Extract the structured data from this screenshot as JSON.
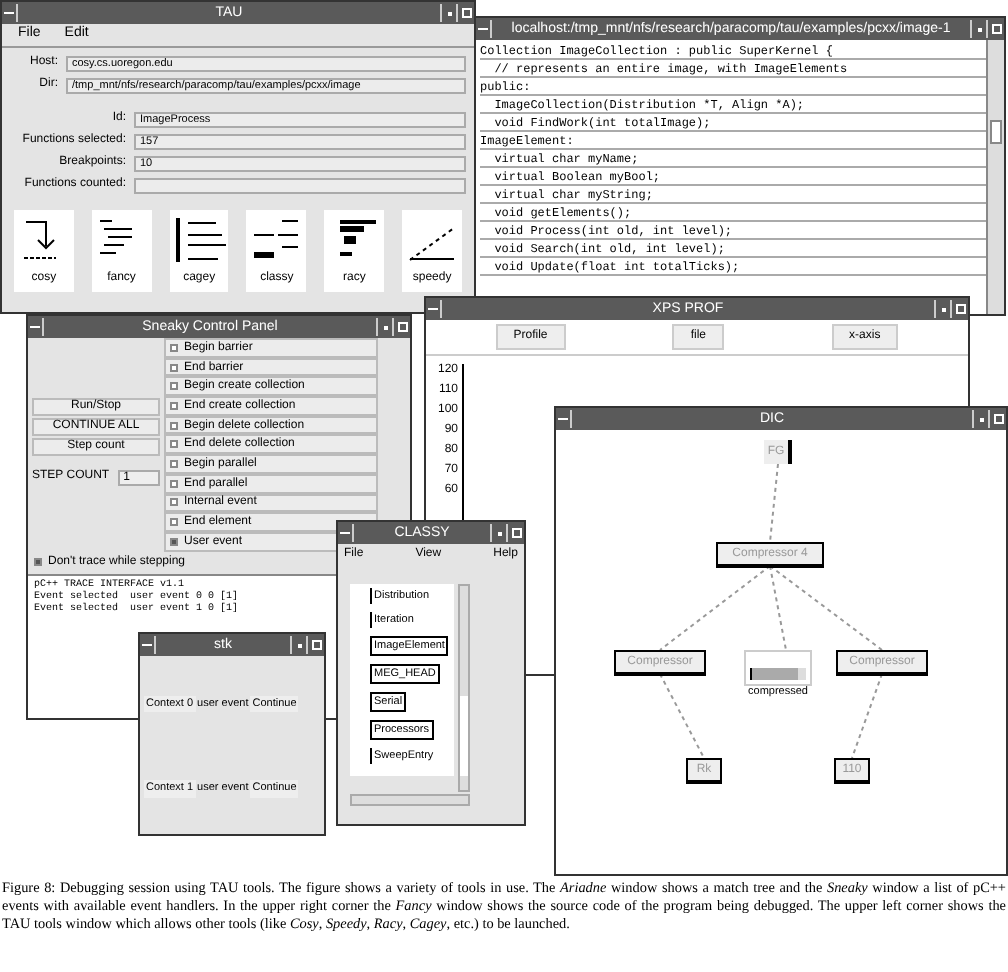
{
  "tau": {
    "title": "TAU",
    "menu": [
      "File",
      "Edit"
    ],
    "fields": [
      {
        "label": "Host:",
        "value": "cosy.cs.uoregon.edu"
      },
      {
        "label": "Dir:",
        "value": "/tmp_mnt/nfs/research/paracomp/tau/examples/pcxx/image"
      },
      {
        "label": "Id:",
        "value": "ImageProcess"
      },
      {
        "label": "Functions selected:",
        "value": "157"
      },
      {
        "label": "Breakpoints:",
        "value": "10"
      },
      {
        "label": "Functions counted:"
      }
    ],
    "tools": [
      {
        "label": "cosy"
      },
      {
        "label": "fancy"
      },
      {
        "label": "cagey"
      },
      {
        "label": "classy"
      },
      {
        "label": "racy"
      },
      {
        "label": "speedy"
      }
    ]
  },
  "fancy": {
    "title": "localhost:/tmp_mnt/nfs/research/paracomp/tau/examples/pcxx/image-1",
    "lines": [
      "Collection ImageCollection : public SuperKernel {",
      "  // represents an entire image, with ImageElements",
      "public:",
      "  ImageCollection(Distribution *T, Align *A);",
      "  void FindWork(int totalImage);",
      "ImageElement:",
      "  virtual char myName;",
      "  virtual Boolean myBool;",
      "  virtual char myString;",
      "  void getElements();",
      "  void Process(int old, int level);",
      "  void Search(int old, int level);",
      "  void Update(float int totalTicks);"
    ]
  },
  "xps": {
    "title": "XPS PROF",
    "buttons": [
      "Profile",
      "file",
      "x-axis"
    ],
    "yticks": [
      "120",
      "110",
      "100",
      "90",
      "80",
      "70",
      "60"
    ]
  },
  "sneaky": {
    "title": "Sneaky Control Panel",
    "buttons": [
      "Run/Stop",
      "CONTINUE ALL",
      "Step count"
    ],
    "step": {
      "label": "STEP COUNT",
      "value": "1"
    },
    "events": [
      {
        "label": "Begin barrier",
        "checked": false
      },
      {
        "label": "End barrier",
        "checked": false
      },
      {
        "label": "Begin create collection",
        "checked": false
      },
      {
        "label": "End create collection",
        "checked": false
      },
      {
        "label": "Begin delete collection",
        "checked": false
      },
      {
        "label": "End delete collection",
        "checked": false
      },
      {
        "label": "Begin parallel",
        "checked": false
      },
      {
        "label": "End parallel",
        "checked": false
      },
      {
        "label": "Internal event",
        "checked": false
      },
      {
        "label": "End element",
        "checked": false
      },
      {
        "label": "User event",
        "checked": true
      }
    ],
    "trace_option": {
      "label": "Don't trace while stepping",
      "checked": true
    },
    "output": [
      "pC++ TRACE INTERFACE v1.1",
      "Event selected  user event 0 0 [1]",
      "Event selected  user event 1 0 [1]"
    ]
  },
  "dic": {
    "title": "DIC",
    "nodes": [
      {
        "label": "FG",
        "kind": "root"
      },
      {
        "label": "Compressor 4",
        "kind": "box"
      },
      {
        "label": "Compressor",
        "kind": "box"
      },
      {
        "label": "compressed",
        "kind": "gauge",
        "level": 0.85
      },
      {
        "label": "Compressor",
        "kind": "box"
      },
      {
        "label": "Rk",
        "kind": "box"
      },
      {
        "label": "110",
        "kind": "box"
      }
    ]
  },
  "clarry": {
    "title": "CLASSY",
    "menu": [
      "File",
      "View",
      "Help"
    ],
    "items": [
      {
        "label": "Distribution",
        "boxed": false
      },
      {
        "label": "Iteration",
        "boxed": false
      },
      {
        "label": "ImageElement",
        "boxed": true
      },
      {
        "label": "MEG_HEAD",
        "boxed": true
      },
      {
        "label": "Serial",
        "boxed": true
      },
      {
        "label": "Processors",
        "boxed": true
      },
      {
        "label": "SweepEntry",
        "boxed": false
      }
    ]
  },
  "stk": {
    "title": "stk",
    "rows": [
      {
        "context": "Context 0",
        "event": "user event",
        "button": "Continue"
      },
      {
        "context": "Context 1",
        "event": "user event",
        "button": "Continue"
      }
    ]
  },
  "caption": "Figure 8: Debugging session using TAU tools. The figure shows a variety of tools in use. The *Ariadne* window shows a match tree and the *Sneaky* window a list of pC++ events with available event handlers. In the upper right corner the *Fancy* window shows the source code of the program being debugged. The upper left corner shows the TAU tools window which allows other tools (like *Cosy*, *Speedy*, *Racy*, *Cagey*, etc.) to be launched."
}
